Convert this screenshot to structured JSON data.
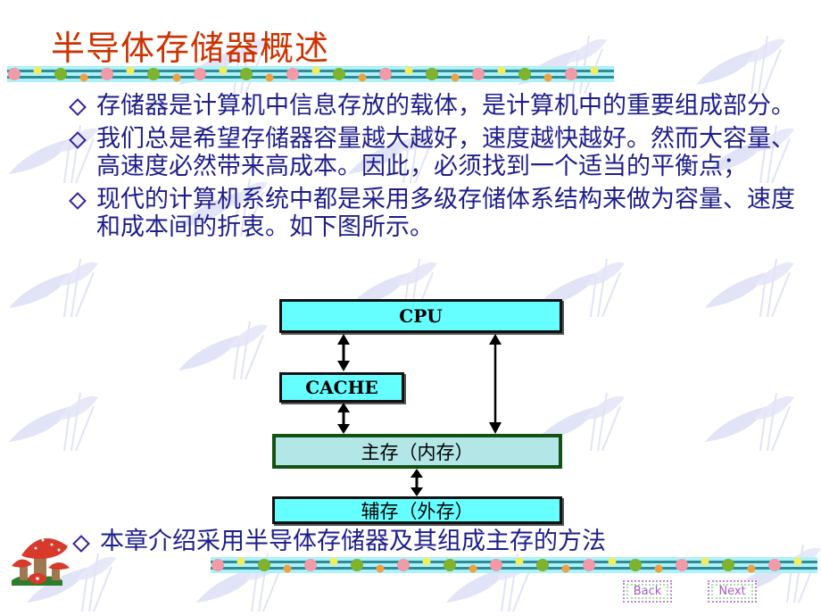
{
  "slide": {
    "title": "半导体存储器概述",
    "bullets": [
      "存储器是计算机中信息存放的载体，是计算机中的重要组成部分。",
      "我们总是希望存储器容量越大越好，速度越快越好。然而大容量、高速度必然带来高成本。因此，必须找到一个适当的平衡点；",
      "现代的计算机系统中都是采用多级存储体系结构来做为容量、速度和成本间的折衷。如下图所示。"
    ],
    "last_bullet": "本章介绍采用半导体存储器及其组成主存的方法",
    "colors": {
      "title": "#cc3300",
      "body_text": "#1e1e8c",
      "box_cyan": "#66ffff",
      "box_main": "#b3e6e6",
      "box_main_border": "#145214"
    }
  },
  "diagram": {
    "nodes": {
      "cpu": "CPU",
      "cache": "CACHE",
      "main_memory": "主存（内存）",
      "secondary_memory": "辅存（外存）"
    },
    "edges": [
      {
        "from": "cpu",
        "to": "cache",
        "type": "bidirectional"
      },
      {
        "from": "cache",
        "to": "main_memory",
        "type": "bidirectional"
      },
      {
        "from": "cpu",
        "to": "main_memory",
        "type": "bidirectional"
      },
      {
        "from": "main_memory",
        "to": "secondary_memory",
        "type": "bidirectional"
      }
    ]
  },
  "navigation": {
    "back_label": "Back",
    "next_label": "Next"
  },
  "icons": {
    "decoration": "mushroom-icon",
    "bullet": "diamond-bullet-icon"
  }
}
